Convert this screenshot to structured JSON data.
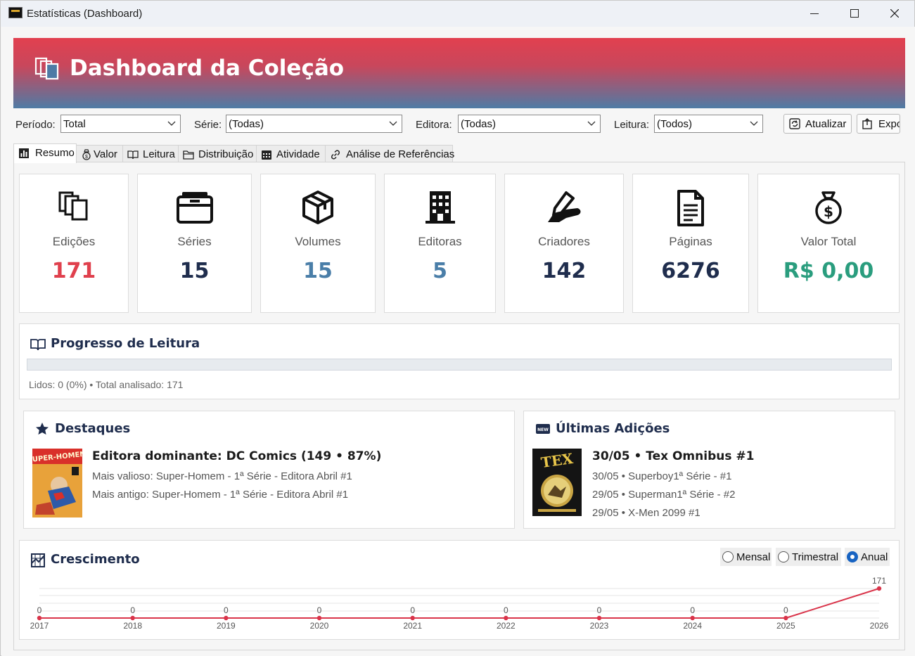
{
  "window": {
    "title": "Estatísticas (Dashboard)"
  },
  "banner": {
    "title": "Dashboard da Coleção"
  },
  "filters": {
    "periodo": {
      "label": "Período:",
      "value": "Total"
    },
    "serie": {
      "label": "Série:",
      "value": "(Todas)"
    },
    "editora": {
      "label": "Editora:",
      "value": "(Todas)"
    },
    "leitura": {
      "label": "Leitura:",
      "value": "(Todos)"
    },
    "refresh_label": "Atualizar",
    "export_label": "Expo"
  },
  "tabs": [
    {
      "label": "Resumo",
      "icon": "bar-chart-icon"
    },
    {
      "label": "Valor",
      "icon": "money-bag-icon"
    },
    {
      "label": "Leitura",
      "icon": "book-icon"
    },
    {
      "label": "Distribuição",
      "icon": "folder-icon"
    },
    {
      "label": "Atividade",
      "icon": "calendar-icon"
    },
    {
      "label": "Análise de Referências",
      "icon": "link-icon"
    }
  ],
  "stats": [
    {
      "label": "Edições",
      "value": "171",
      "color": "#e0404d",
      "icon": "copies-icon"
    },
    {
      "label": "Séries",
      "value": "15",
      "color": "#1f2d4d",
      "icon": "folder-box-icon"
    },
    {
      "label": "Volumes",
      "value": "15",
      "color": "#4a7ea8",
      "icon": "box-icon"
    },
    {
      "label": "Editoras",
      "value": "5",
      "color": "#4a7ea8",
      "icon": "building-icon"
    },
    {
      "label": "Criadores",
      "value": "142",
      "color": "#1f2d4d",
      "icon": "pen-hand-icon"
    },
    {
      "label": "Páginas",
      "value": "6276",
      "color": "#1f2d4d",
      "icon": "document-icon"
    },
    {
      "label": "Valor Total",
      "value": "R$ 0,00",
      "color": "#2a9d7e",
      "icon": "money-bag-icon"
    }
  ],
  "reading_progress": {
    "title": "Progresso de Leitura",
    "percent": 0,
    "text": "Lidos: 0 (0%) • Total analisado: 171"
  },
  "highlights": {
    "title": "Destaques",
    "main": "Editora dominante: DC Comics (149 • 87%)",
    "lines": [
      "Mais valioso: Super-Homem - 1ª Série - Editora Abril #1",
      "Mais antigo: Super-Homem - 1ª Série - Editora Abril #1"
    ],
    "cover_text": "SUPER-HOMEM"
  },
  "recent": {
    "title": "Últimas Adições",
    "main": "30/05 • Tex Omnibus #1",
    "lines": [
      "30/05 • Superboy1ª Série - #1",
      "29/05 • Superman1ª Série - #2",
      "29/05 • X-Men 2099 #1"
    ],
    "cover_text": "TEX"
  },
  "growth": {
    "title": "Crescimento",
    "options": [
      "Mensal",
      "Trimestral",
      "Anual"
    ],
    "selected": "Anual"
  },
  "chart_data": {
    "type": "line",
    "x": [
      "2017",
      "2018",
      "2019",
      "2020",
      "2021",
      "2022",
      "2023",
      "2024",
      "2025",
      "2026"
    ],
    "series": [
      {
        "values": [
          0,
          0,
          0,
          0,
          0,
          0,
          0,
          0,
          0,
          171
        ],
        "color": "#d9344a"
      }
    ],
    "data_labels": [
      "0",
      "0",
      "0",
      "0",
      "0",
      "0",
      "0",
      "0",
      "0",
      "171"
    ],
    "grid": true
  }
}
